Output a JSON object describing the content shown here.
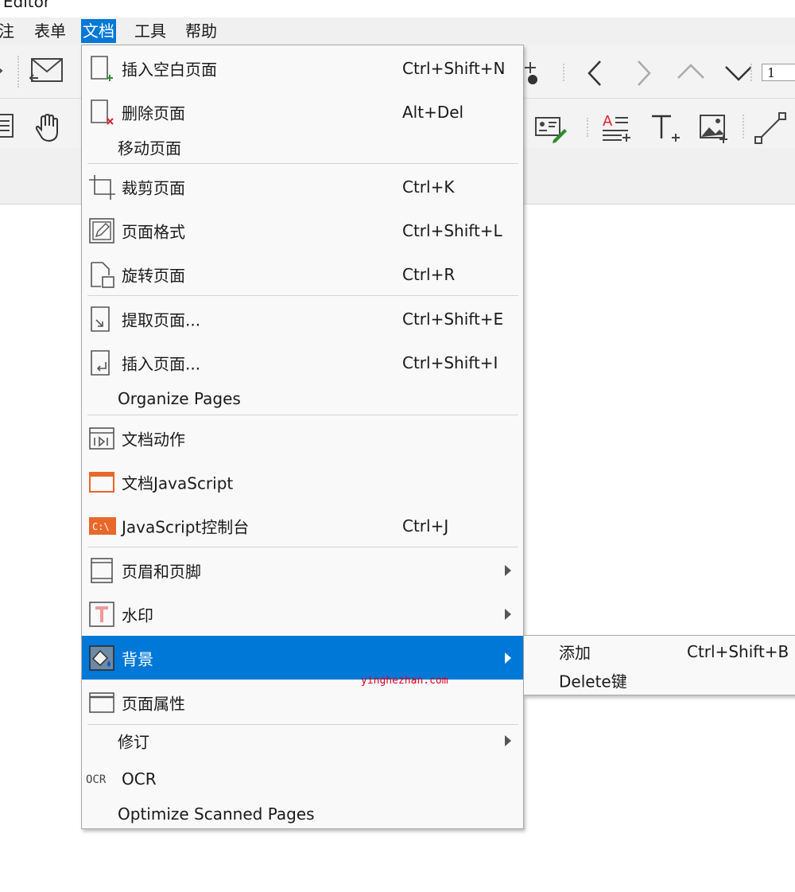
{
  "window": {
    "title": "F Editor"
  },
  "menubar": [
    {
      "label": "注"
    },
    {
      "label": "表单"
    },
    {
      "label": "文档"
    },
    {
      "label": "工具"
    },
    {
      "label": "帮助"
    }
  ],
  "toolbar": {
    "page_number": "1",
    "icons": [
      "undo-icon",
      "mail-icon",
      "add-point-icon",
      "previous-page-icon",
      "next-page-icon",
      "first-page-icon",
      "last-page-icon",
      "text-view-icon",
      "hand-tool-icon",
      "signature-icon",
      "add-text-field-icon",
      "add-text-icon",
      "add-image-icon",
      "line-tool-icon"
    ]
  },
  "document_menu": {
    "items": [
      {
        "label": "插入空白页面",
        "shortcut": "Ctrl+Shift+N",
        "icon": "insert-blank-page-icon"
      },
      {
        "label": "删除页面",
        "shortcut": "Alt+Del",
        "icon": "delete-page-icon"
      },
      {
        "label": "移动页面",
        "shortcut": ""
      },
      {
        "label": "裁剪页面",
        "shortcut": "Ctrl+K",
        "icon": "crop-page-icon"
      },
      {
        "label": "页面格式",
        "shortcut": "Ctrl+Shift+L",
        "icon": "page-format-icon"
      },
      {
        "label": "旋转页面",
        "shortcut": "Ctrl+R",
        "icon": "rotate-page-icon"
      },
      {
        "label": "提取页面...",
        "shortcut": "Ctrl+Shift+E",
        "icon": "extract-page-icon"
      },
      {
        "label": "插入页面...",
        "shortcut": "Ctrl+Shift+I",
        "icon": "insert-page-icon"
      },
      {
        "label": "Organize Pages",
        "shortcut": ""
      },
      {
        "label": "文档动作",
        "shortcut": "",
        "icon": "document-actions-icon"
      },
      {
        "label": "文档JavaScript",
        "shortcut": "",
        "icon": "document-javascript-icon"
      },
      {
        "label": "JavaScript控制台",
        "shortcut": "Ctrl+J",
        "icon": "javascript-console-icon",
        "icon_text": "C:\\"
      },
      {
        "label": "页眉和页脚",
        "shortcut": "",
        "icon": "header-footer-icon"
      },
      {
        "label": "水印",
        "shortcut": "",
        "icon": "watermark-icon"
      },
      {
        "label": "背景",
        "shortcut": "",
        "icon": "background-icon"
      },
      {
        "label": "页面属性",
        "shortcut": "",
        "icon": "page-properties-icon"
      },
      {
        "label": "修订",
        "shortcut": ""
      },
      {
        "label": "OCR",
        "shortcut": "",
        "icon": "ocr-icon",
        "icon_text": "OCR"
      },
      {
        "label": "Optimize Scanned Pages",
        "shortcut": ""
      }
    ]
  },
  "background_submenu": {
    "items": [
      {
        "label": "添加",
        "shortcut": "Ctrl+Shift+B"
      },
      {
        "label": "Delete键",
        "shortcut": ""
      }
    ]
  },
  "watermark_text": "yinghezhan.com",
  "colors": {
    "highlight": "#0078d7",
    "menu_bg": "#f9f9f9",
    "toolbar_bg": "#f3f3f3",
    "accent_orange": "#e8672a",
    "add_green": "#2e8b2e",
    "delete_red": "#d9262b"
  }
}
